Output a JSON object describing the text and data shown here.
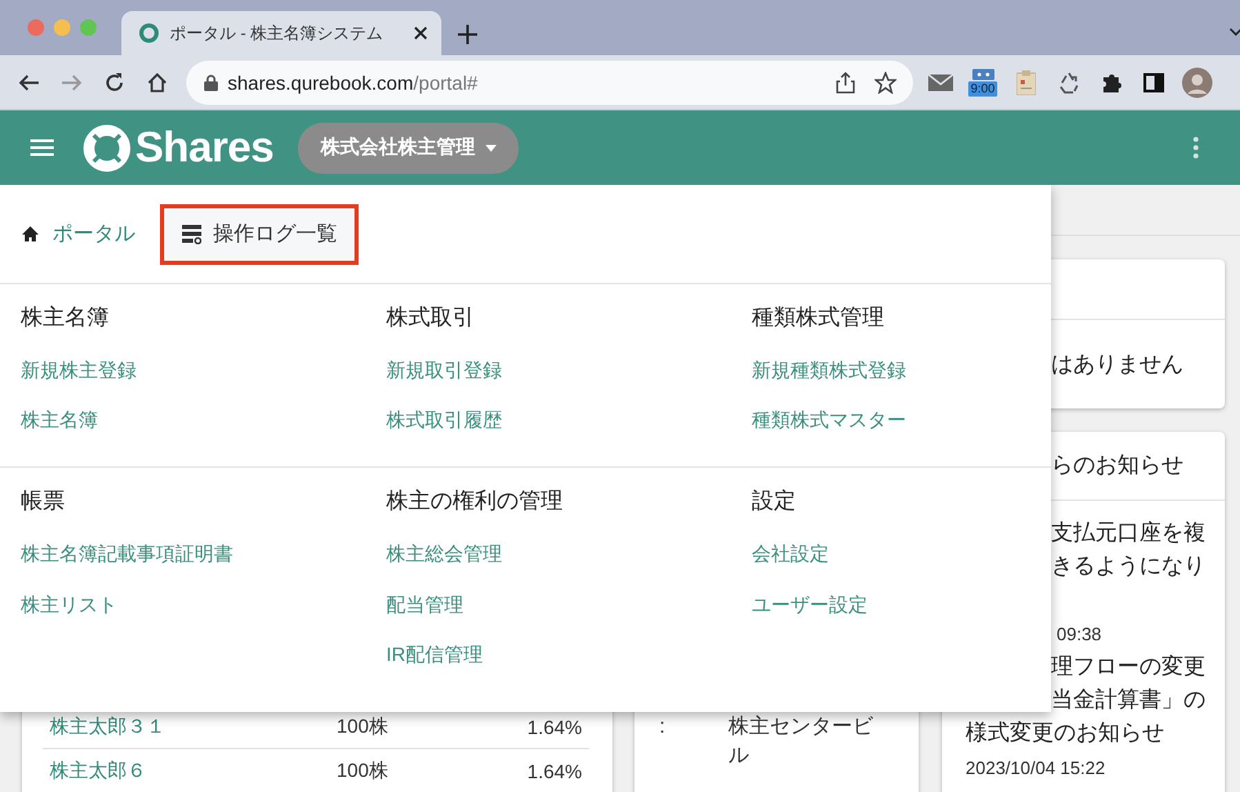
{
  "browser": {
    "tab": {
      "title": "ポータル - 株主名簿システム",
      "selected": true
    },
    "address": {
      "host": "shares.qurebook.com",
      "path": "/portal#"
    },
    "extension_badge": "9:00"
  },
  "app_bar": {
    "logo": "Shares",
    "company_menu": "株式会社株主管理"
  },
  "menu": {
    "breadcrumb": [
      {
        "kind": "link",
        "label": "ポータル",
        "highlighted": false
      },
      {
        "kind": "current",
        "label": "操作ログ一覧",
        "highlighted": true
      }
    ],
    "section_rows": [
      [
        {
          "title": "株主名簿",
          "links": [
            "新規株主登録",
            "株主名簿"
          ]
        },
        {
          "title": "株式取引",
          "links": [
            "新規取引登録",
            "株式取引履歴"
          ]
        },
        {
          "title": "種類株式管理",
          "links": [
            "新規種類株式登録",
            "種類株式マスター"
          ]
        }
      ],
      [
        {
          "title": "帳票",
          "links": [
            "株主名簿記載事項証明書",
            "株主リスト"
          ]
        },
        {
          "title": "株主の権利の管理",
          "links": [
            "株主総会管理",
            "配当管理",
            "IR配信管理"
          ]
        },
        {
          "title": "設定",
          "links": [
            "会社設定",
            "ユーザー設定"
          ]
        }
      ]
    ]
  },
  "background": {
    "shareholder_rows": [
      {
        "name": "株主太郎３１",
        "shares": "100株",
        "ratio": "1.64%"
      },
      {
        "name": "株主太郎６",
        "shares": "100株",
        "ratio": "1.64%"
      }
    ],
    "address": {
      "separator": ":",
      "value": "株主センタービル"
    },
    "alert_card": {
      "body": "はありません"
    },
    "notice_card": {
      "title": "らのお知らせ",
      "items": [
        {
          "lines": [
            "支払元口座を複",
            "きるようになり"
          ],
          "date": "09:38"
        },
        {
          "lines": [
            "理フローの変更",
            "当金計算書」の",
            "様式変更のお知らせ"
          ],
          "date": "2023/10/04 15:22"
        }
      ]
    }
  }
}
